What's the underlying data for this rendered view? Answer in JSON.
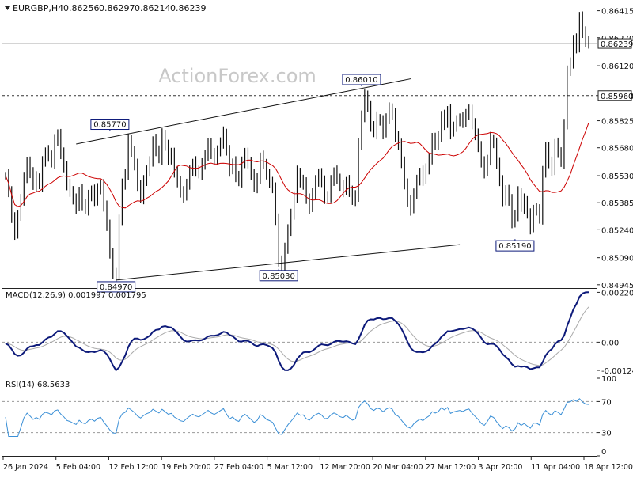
{
  "header": {
    "symbol": "EURGBP,H4",
    "open": "0.86256",
    "high": "0.86297",
    "low": "0.86214",
    "close": "0.86239"
  },
  "watermark": "ActionForex.com",
  "colors": {
    "candle": "#111111",
    "ma": "#cc0000",
    "macd": "#0d1a7a",
    "signal": "#aaaaaa",
    "rsi": "#3a8fd6",
    "grid_dash": "#999999",
    "box_border": "#0d1a7a"
  },
  "chart_data": [
    {
      "type": "candlestick",
      "panel": "price",
      "ylim": [
        0.8494,
        0.8646
      ],
      "y_ticks": [
        "0.86415",
        "0.86270",
        "0.86120",
        "0.85960",
        "0.85825",
        "0.85680",
        "0.85530",
        "0.85385",
        "0.85240",
        "0.85090",
        "0.84945"
      ],
      "current_price_label": "0.86239",
      "current_price": 0.86239,
      "horizontal_level": 0.8596,
      "level_label": "0.85960",
      "x_labels": [
        "26 Jan 2024",
        "5 Feb 04:00",
        "12 Feb 12:00",
        "19 Feb 20:00",
        "27 Feb 04:00",
        "5 Mar 12:00",
        "12 Mar 20:00",
        "20 Mar 04:00",
        "27 Mar 12:00",
        "3 Apr 20:00",
        "11 Apr 04:00",
        "18 Apr 12:00"
      ],
      "annotations": [
        {
          "text": "0.85770",
          "price": 0.8577,
          "bar": 34
        },
        {
          "text": "0.84970",
          "price": 0.8497,
          "bar": 36
        },
        {
          "text": "0.85030",
          "price": 0.8503,
          "bar": 89
        },
        {
          "text": "0.86010",
          "price": 0.8601,
          "bar": 116
        },
        {
          "text": "0.85190",
          "price": 0.8519,
          "bar": 166
        }
      ],
      "channel_lines": [
        {
          "from": [
            23,
            0.857
          ],
          "to": [
            132,
            0.8605
          ]
        },
        {
          "from": [
            36,
            0.8497
          ],
          "to": [
            148,
            0.8516
          ]
        }
      ],
      "closes": [
        0.8553,
        0.8545,
        0.853,
        0.8522,
        0.8532,
        0.854,
        0.8552,
        0.856,
        0.8555,
        0.8548,
        0.8552,
        0.8548,
        0.856,
        0.8566,
        0.8564,
        0.856,
        0.8572,
        0.8575,
        0.8565,
        0.8558,
        0.8548,
        0.8545,
        0.854,
        0.8536,
        0.8545,
        0.8538,
        0.8535,
        0.8542,
        0.8545,
        0.854,
        0.8546,
        0.8548,
        0.8537,
        0.8526,
        0.8512,
        0.85,
        0.8499,
        0.853,
        0.8548,
        0.8554,
        0.8572,
        0.8566,
        0.8559,
        0.8548,
        0.8541,
        0.855,
        0.8556,
        0.856,
        0.8572,
        0.8567,
        0.8562,
        0.8575,
        0.8569,
        0.8562,
        0.8565,
        0.8555,
        0.855,
        0.8544,
        0.8542,
        0.8549,
        0.8555,
        0.856,
        0.8556,
        0.8554,
        0.8559,
        0.8564,
        0.857,
        0.8565,
        0.8562,
        0.8566,
        0.8571,
        0.8576,
        0.8566,
        0.8556,
        0.856,
        0.8553,
        0.855,
        0.856,
        0.8565,
        0.856,
        0.8554,
        0.8547,
        0.8551,
        0.8563,
        0.856,
        0.8553,
        0.855,
        0.8546,
        0.853,
        0.8507,
        0.8505,
        0.8514,
        0.8524,
        0.8532,
        0.8542,
        0.8555,
        0.8549,
        0.855,
        0.854,
        0.8536,
        0.8544,
        0.855,
        0.8554,
        0.855,
        0.8541,
        0.8542,
        0.855,
        0.8555,
        0.8552,
        0.8547,
        0.8545,
        0.855,
        0.8545,
        0.854,
        0.8542,
        0.857,
        0.8585,
        0.8596,
        0.859,
        0.858,
        0.8576,
        0.8584,
        0.8582,
        0.8576,
        0.8584,
        0.8589,
        0.8586,
        0.8574,
        0.857,
        0.856,
        0.8549,
        0.8539,
        0.8535,
        0.8544,
        0.855,
        0.8555,
        0.8551,
        0.8557,
        0.8562,
        0.8573,
        0.857,
        0.8574,
        0.8585,
        0.8581,
        0.8588,
        0.8576,
        0.858,
        0.8582,
        0.8584,
        0.8582,
        0.8586,
        0.8588,
        0.8581,
        0.8575,
        0.8569,
        0.856,
        0.8555,
        0.8562,
        0.8573,
        0.857,
        0.856,
        0.855,
        0.854,
        0.8545,
        0.854,
        0.8528,
        0.8532,
        0.8544,
        0.8536,
        0.854,
        0.8532,
        0.8525,
        0.8535,
        0.8535,
        0.853,
        0.8555,
        0.8568,
        0.856,
        0.8556,
        0.857,
        0.8566,
        0.856,
        0.858,
        0.861,
        0.8613,
        0.8626,
        0.8622,
        0.8638,
        0.863,
        0.8625,
        0.8624
      ]
    },
    {
      "type": "line",
      "panel": "macd",
      "label": "MACD(12,26,9) 0.001997 0.001795",
      "y_ticks": [
        "0.002201",
        "0.00",
        "-0.001246"
      ],
      "ylim": [
        -0.00135,
        0.00232
      ],
      "zero_label": "0.00"
    },
    {
      "type": "line",
      "panel": "rsi",
      "label": "RSI(14) 68.5633",
      "y_ticks": [
        "100",
        "70",
        "30",
        "0"
      ],
      "ylim": [
        0,
        100
      ],
      "levels": [
        70,
        30
      ]
    }
  ]
}
